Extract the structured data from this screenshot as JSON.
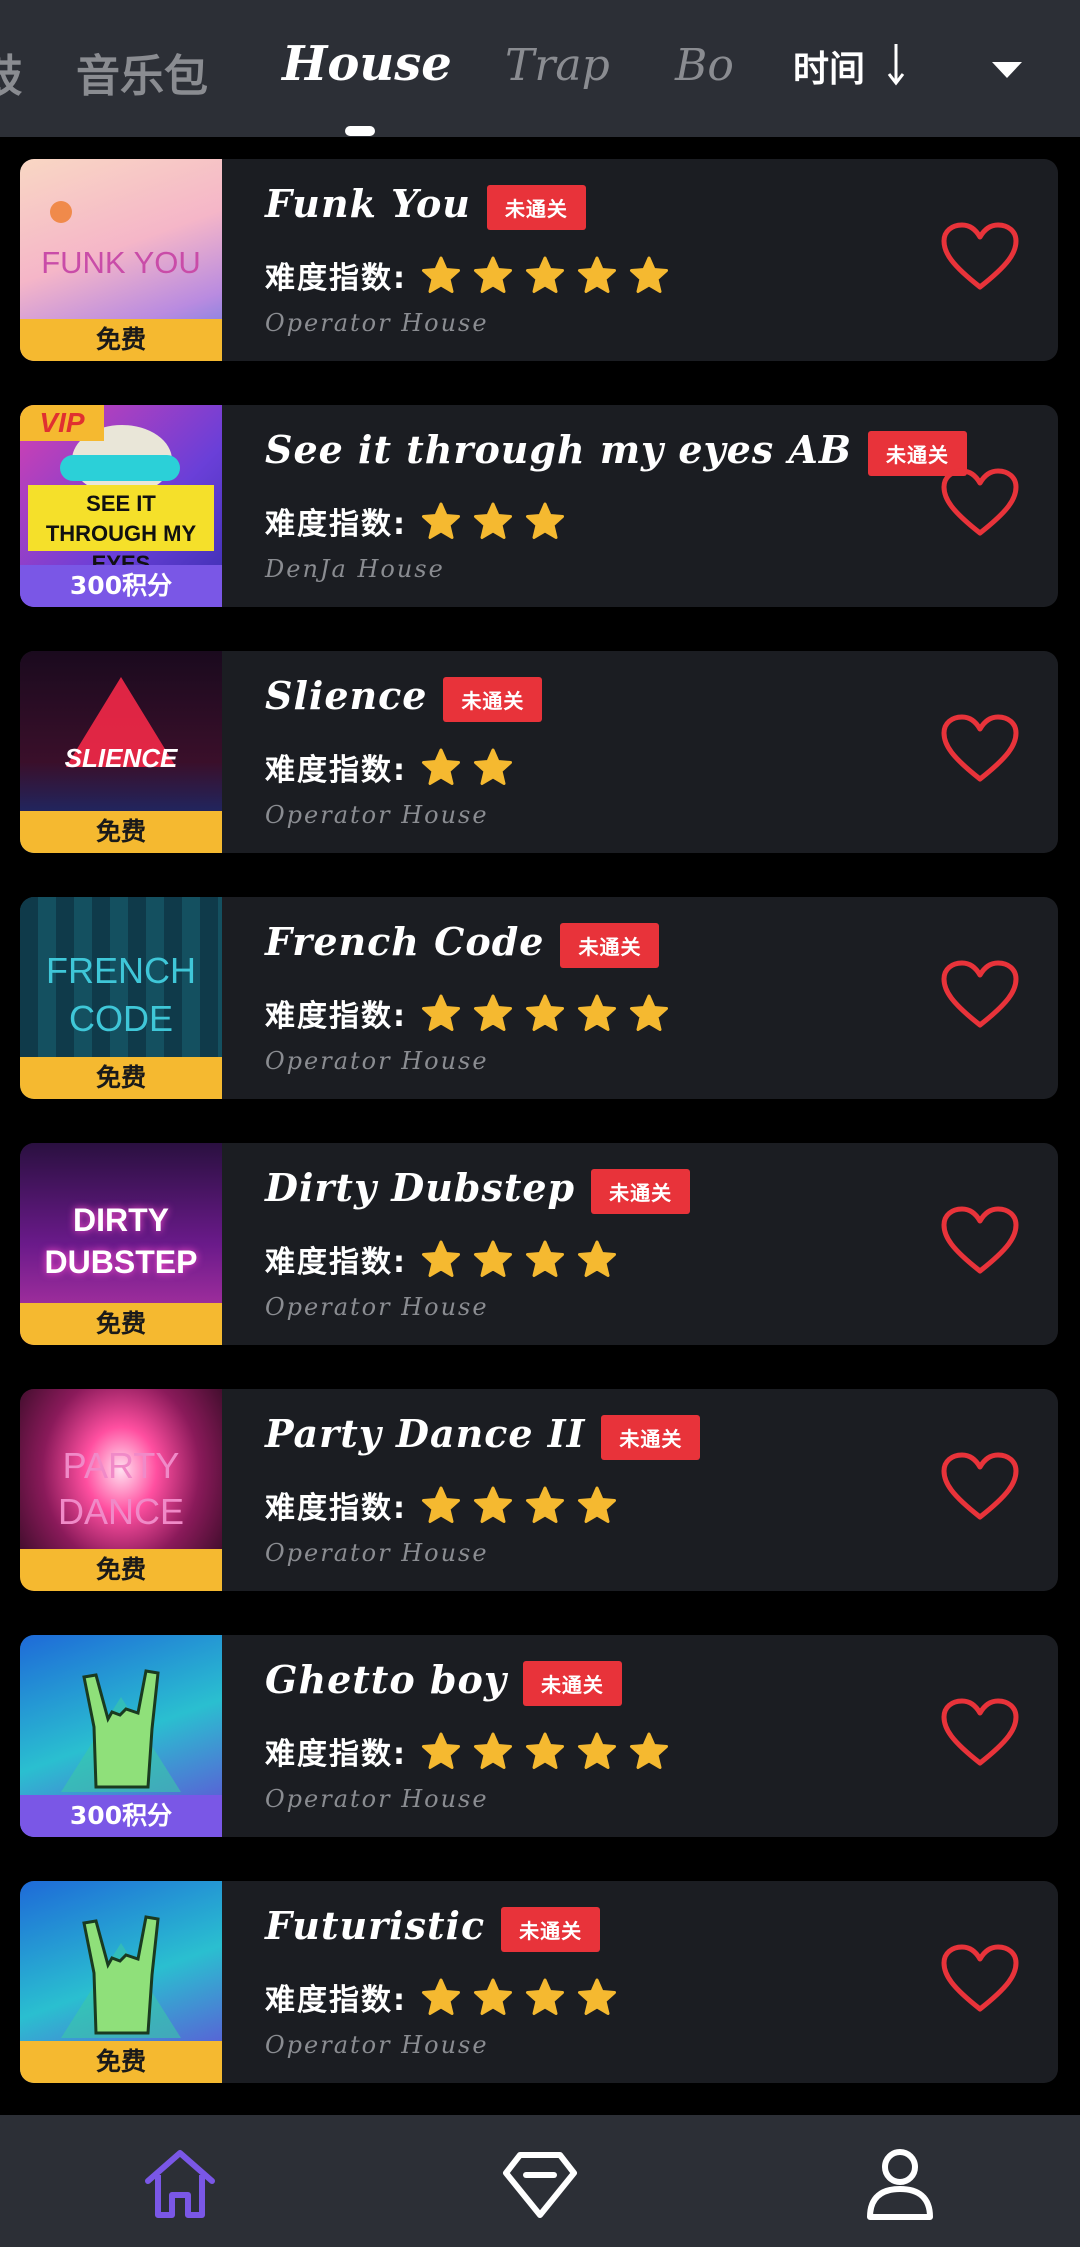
{
  "tabs": {
    "items": [
      {
        "label": "鼓",
        "active": false
      },
      {
        "label": "音乐包",
        "active": false
      },
      {
        "label": "House",
        "active": true
      },
      {
        "label": "Trap",
        "active": false
      },
      {
        "label": "Bo",
        "active": false
      }
    ],
    "sort_label": "时间"
  },
  "list": {
    "difficulty_label": "难度指数:",
    "items": [
      {
        "title": "Funk You",
        "badge": "未通关",
        "difficulty": 5,
        "artist": "Operator House",
        "price": "免费",
        "price_type": "free",
        "cover_text": "FUNK YOU",
        "vip": ""
      },
      {
        "title": "See it through my eyes AB",
        "badge": "未通关",
        "difficulty": 3,
        "artist": "DenJa House",
        "price": "300积分",
        "price_type": "paid",
        "cover_text": "SEE IT THROUGH MY EYES",
        "vip": "VIP"
      },
      {
        "title": "Slience",
        "badge": "未通关",
        "difficulty": 2,
        "artist": "Operator House",
        "price": "免费",
        "price_type": "free",
        "cover_text": "SLIENCE",
        "vip": ""
      },
      {
        "title": "French Code",
        "badge": "未通关",
        "difficulty": 5,
        "artist": "Operator House",
        "price": "免费",
        "price_type": "free",
        "cover_text": "FRENCH CODE",
        "vip": ""
      },
      {
        "title": "Dirty Dubstep",
        "badge": "未通关",
        "difficulty": 4,
        "artist": "Operator House",
        "price": "免费",
        "price_type": "free",
        "cover_text": "DIRTY DUBSTEP",
        "vip": ""
      },
      {
        "title": "Party Dance II",
        "badge": "未通关",
        "difficulty": 4,
        "artist": "Operator House",
        "price": "免费",
        "price_type": "free",
        "cover_text": "PARTY DANCE",
        "vip": ""
      },
      {
        "title": "Ghetto boy",
        "badge": "未通关",
        "difficulty": 5,
        "artist": "Operator House",
        "price": "300积分",
        "price_type": "paid",
        "cover_text": "",
        "vip": ""
      },
      {
        "title": "Futuristic",
        "badge": "未通关",
        "difficulty": 4,
        "artist": "Operator House",
        "price": "免费",
        "price_type": "free",
        "cover_text": "",
        "vip": ""
      }
    ]
  },
  "bottom_nav": {
    "items": [
      {
        "icon": "home-icon",
        "active": true
      },
      {
        "icon": "diamond-icon",
        "active": false
      },
      {
        "icon": "user-icon",
        "active": false
      }
    ]
  },
  "colors": {
    "accent": "#7a57e6",
    "star": "#f5b930",
    "heart": "#e8333a",
    "badge": "#e8333a",
    "free_tag": "#f5b930",
    "paid_tag": "#7a57e6",
    "card_bg": "#1b1d22",
    "bar_bg": "#2c2f36"
  }
}
